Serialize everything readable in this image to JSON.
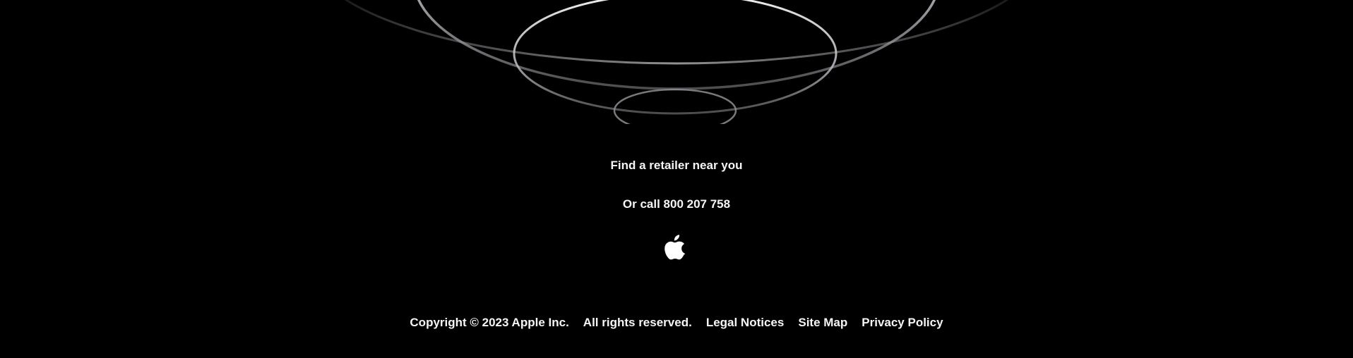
{
  "hero": {
    "decoration": "concentric-rings-graphic"
  },
  "cta": {
    "retailer_label": "Find a retailer near you",
    "call_label": "Or call 800 207 758"
  },
  "logo": {
    "icon": "apple-logo-icon"
  },
  "footer": {
    "copyright": "Copyright © 2023 Apple Inc.",
    "rights": "All rights reserved.",
    "links": [
      {
        "label": "Legal Notices"
      },
      {
        "label": "Site Map"
      },
      {
        "label": "Privacy Policy"
      }
    ]
  },
  "colors": {
    "background": "#000000",
    "text": "#f5f5f7",
    "ring": "#c8c8cc"
  }
}
